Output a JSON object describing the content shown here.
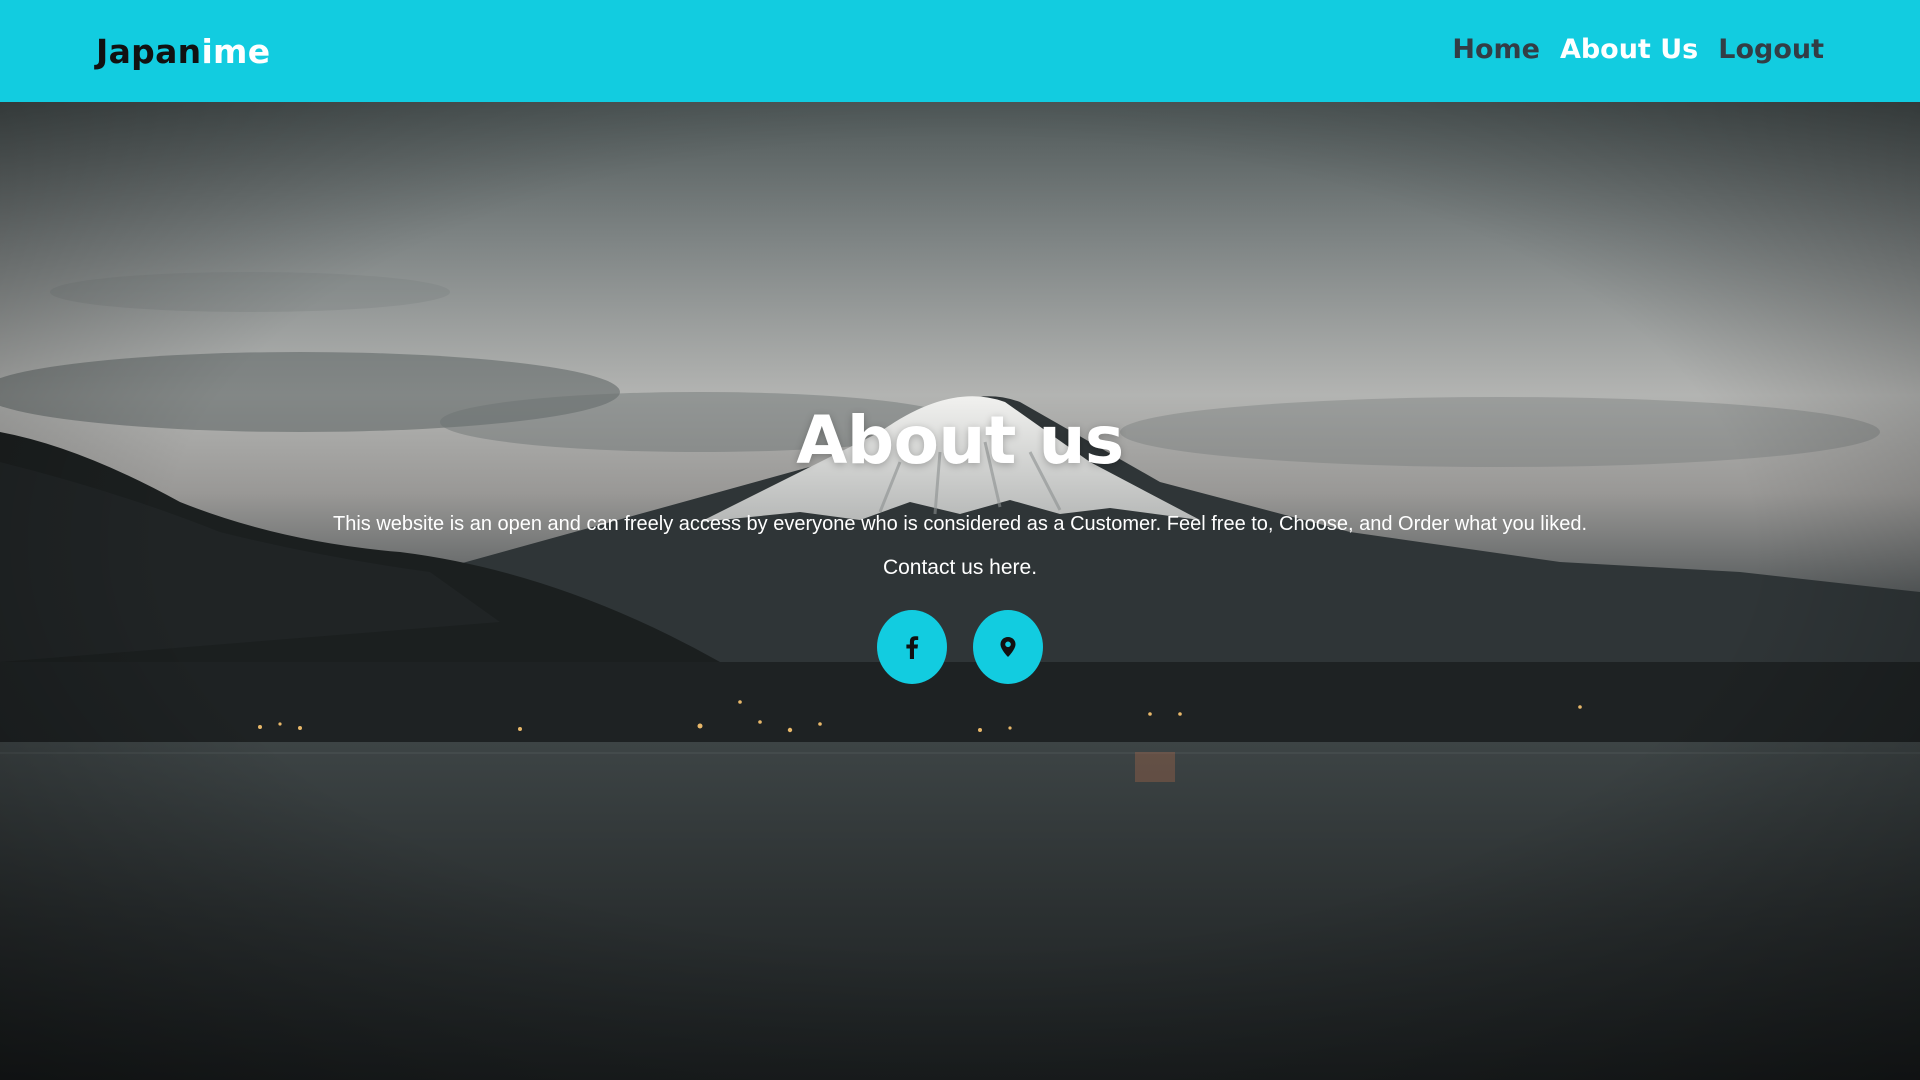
{
  "brand": {
    "name_part1": "Japan",
    "name_part2": "ime"
  },
  "nav": {
    "items": [
      {
        "label": "Home",
        "active": false
      },
      {
        "label": "About Us",
        "active": true
      },
      {
        "label": "Logout",
        "active": false
      }
    ]
  },
  "hero": {
    "title": "About us",
    "description": "This website is an open and can freely access by everyone who is considered as a Customer. Feel free to, Choose, and Order what you liked.",
    "contact_text": "Contact us here.",
    "background": "Mount Fuji at dusk over a lake",
    "buttons": [
      {
        "icon": "facebook-icon"
      },
      {
        "icon": "map-pin-icon"
      }
    ]
  },
  "colors": {
    "accent": "#12cce0",
    "nav_text": "#333d45",
    "nav_active": "#ffffff"
  }
}
